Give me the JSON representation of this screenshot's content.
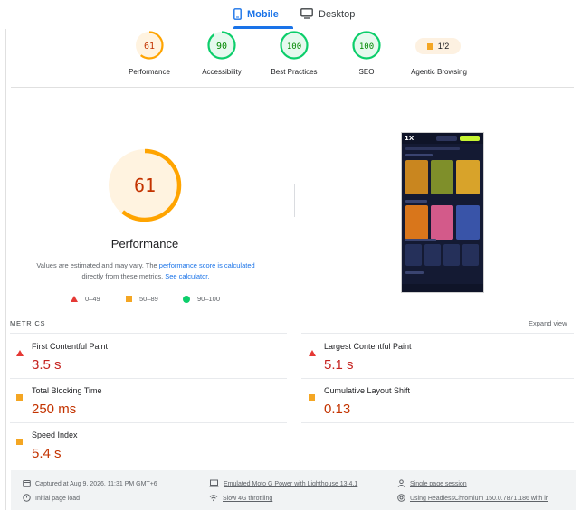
{
  "tabs": [
    {
      "label": "Mobile",
      "icon": "smartphone-icon",
      "active": true
    },
    {
      "label": "Desktop",
      "icon": "monitor-icon",
      "active": false
    }
  ],
  "categories": [
    {
      "label": "Performance",
      "score": "61",
      "value": 61,
      "status": "average"
    },
    {
      "label": "Accessibility",
      "score": "90",
      "value": 90,
      "status": "pass"
    },
    {
      "label": "Best Practices",
      "score": "100",
      "value": 100,
      "status": "pass"
    },
    {
      "label": "SEO",
      "score": "100",
      "value": 100,
      "status": "pass"
    },
    {
      "label": "Agentic Browsing",
      "score": "1/2",
      "status": "average"
    }
  ],
  "performance": {
    "score": "61",
    "value": 61,
    "title": "Performance",
    "note_before": "Values are estimated and may vary. The ",
    "note_link1": "performance score is calculated",
    "note_middle": " directly from these metrics. ",
    "note_link2": "See calculator."
  },
  "legend": [
    {
      "range": "0–49",
      "shape": "triangle"
    },
    {
      "range": "50–89",
      "shape": "square"
    },
    {
      "range": "90–100",
      "shape": "circle"
    }
  ],
  "metrics": {
    "heading": "METRICS",
    "expand_label": "Expand view",
    "items": [
      {
        "label": "First Contentful Paint",
        "value": "3.5 s",
        "status": "fail"
      },
      {
        "label": "Largest Contentful Paint",
        "value": "5.1 s",
        "status": "fail"
      },
      {
        "label": "Total Blocking Time",
        "value": "250 ms",
        "status": "average"
      },
      {
        "label": "Cumulative Layout Shift",
        "value": "0.13",
        "status": "average"
      },
      {
        "label": "Speed Index",
        "value": "5.4 s",
        "status": "average"
      }
    ]
  },
  "footer": {
    "captured": "Captured at Aug 9, 2026, 11:31 PM GMT+6",
    "initial_load": "Initial page load",
    "device": "Emulated Moto G Power with Lighthouse 13.4.1",
    "throttling": "Slow 4G throttling",
    "session": "Single page session",
    "browser": "Using HeadlessChromium 150.0.7871.186 with lr"
  },
  "colors": {
    "accent": "#1a73e8",
    "pass": "#0cce6b",
    "pass_text": "#008800",
    "average": "#ffa400",
    "average_text": "#c33300",
    "fail": "#e53935"
  }
}
